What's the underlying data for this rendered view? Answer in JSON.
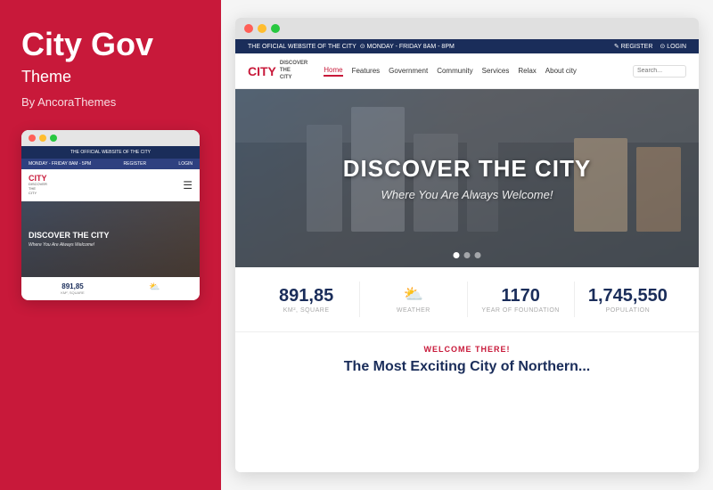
{
  "left": {
    "title": "City Gov",
    "subtitle": "Theme",
    "author": "By AncoraThemes",
    "mini": {
      "topbar": "THE OFFICIAL WEBSITE OF THE CITY",
      "hours": "MONDAY - FRIDAY 8AM - 5PM",
      "register": "REGISTER",
      "login": "LOGIN",
      "logo": "CITY",
      "logo_sub": "DISCOVER\nTHE\nCITY",
      "hero_title": "DISCOVER THE CITY",
      "hero_sub": "Where You Are Always Welcome!",
      "stat_num": "891,85",
      "stat_label": "KM², SQUARE"
    }
  },
  "right": {
    "titlebar_dots": [
      "red",
      "yellow",
      "green"
    ],
    "utility": {
      "left": "THE OFICIAL WEBSITE OF THE CITY",
      "center": "⊙  MONDAY - FRIDAY 8AM - 8PM",
      "register": "✎ REGISTER",
      "login": "⊙ LOGIN"
    },
    "nav": {
      "logo": "CITY",
      "logo_discover": "DISCOVER",
      "logo_the": "THE",
      "logo_city": "CITY",
      "links": [
        "Home",
        "Features",
        "Government",
        "Community",
        "Services",
        "Relax",
        "About city"
      ],
      "active_index": 0,
      "search_placeholder": "Search..."
    },
    "hero": {
      "title": "DISCOVER THE CITY",
      "subtitle": "Where You Are Always Welcome!",
      "dots": [
        true,
        false,
        false
      ]
    },
    "stats": [
      {
        "number": "891,85",
        "label": "KM², SQUARE",
        "icon": ""
      },
      {
        "number": "",
        "label": "WEATHER",
        "icon": "⛅"
      },
      {
        "number": "1170",
        "label": "YEAR OF FOUNDATION",
        "icon": ""
      },
      {
        "number": "1,745,550",
        "label": "POPULATION",
        "icon": ""
      }
    ],
    "welcome": {
      "label": "WELCOME THERE!",
      "text": "The Most Exciting City of Northern..."
    }
  }
}
